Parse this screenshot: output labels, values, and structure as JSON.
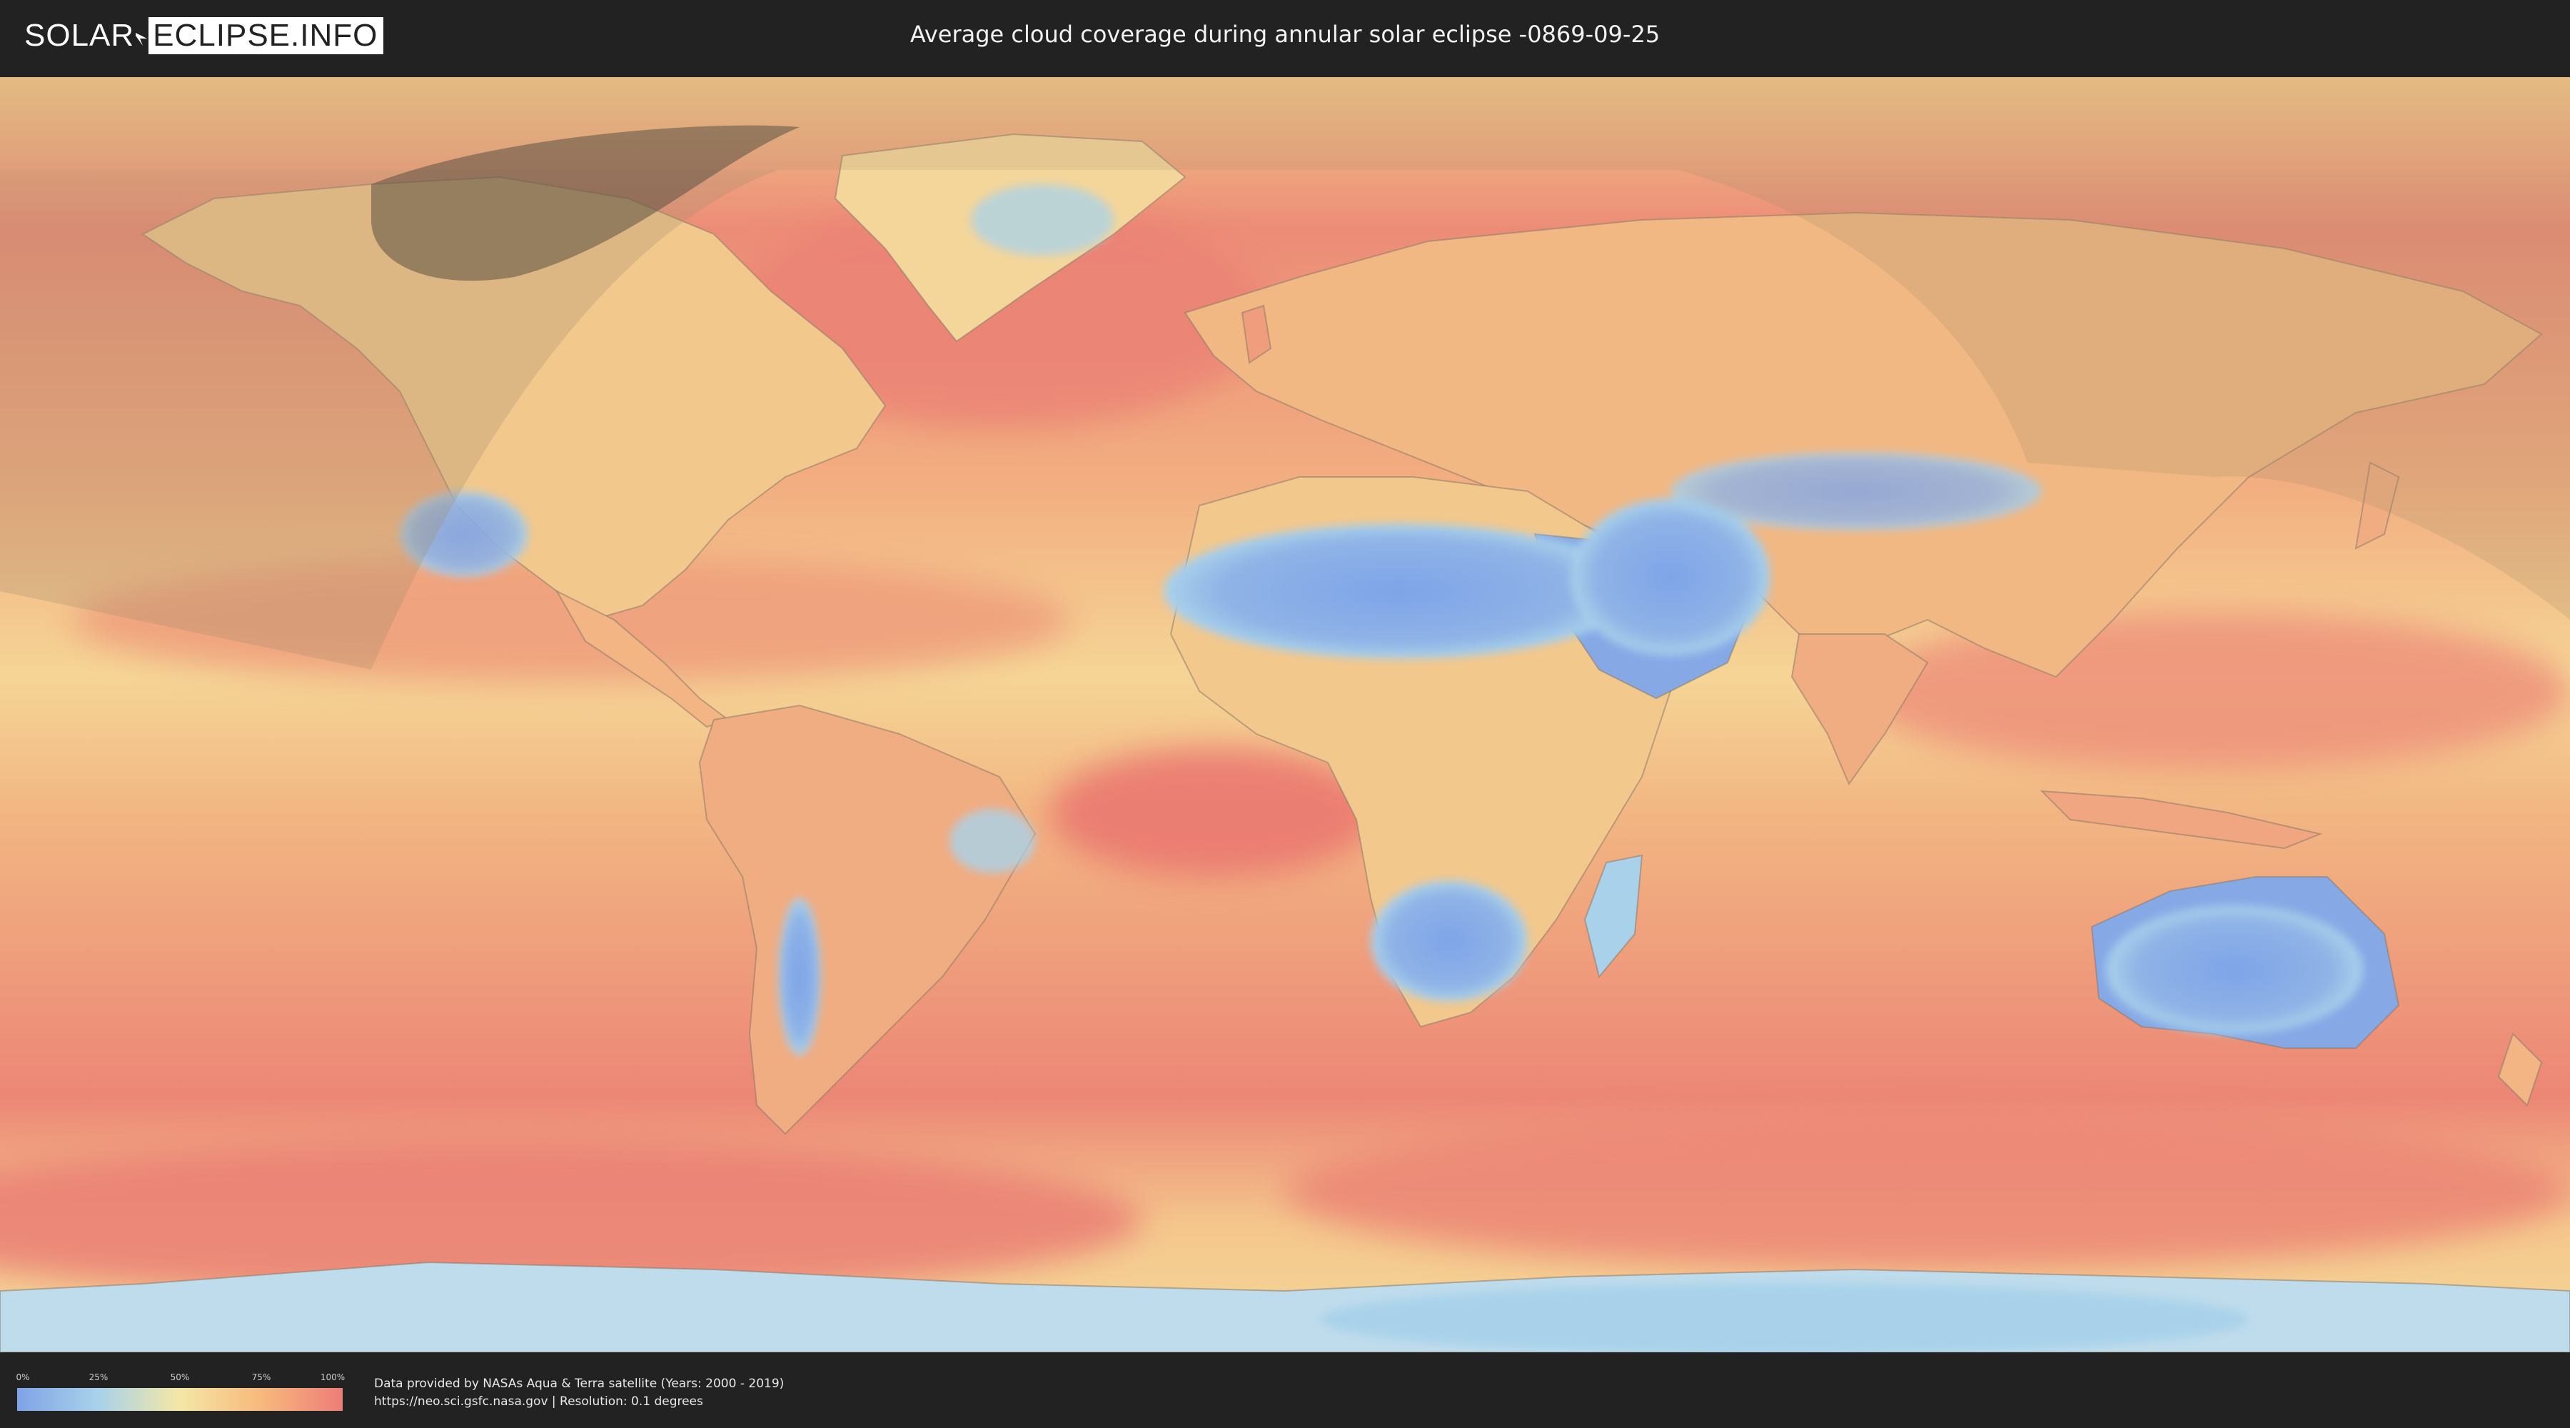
{
  "header": {
    "logo_left": "SOLAR",
    "logo_right": "ECLIPSE.INFO",
    "title": "Average cloud coverage during annular solar eclipse -0869-09-25"
  },
  "legend": {
    "ticks": [
      "0%",
      "25%",
      "50%",
      "75%",
      "100%"
    ],
    "colors": [
      "#7fa3e6",
      "#a9d2ea",
      "#f4e7a6",
      "#f7b97c",
      "#ee7d78"
    ]
  },
  "footer": {
    "credit_line1": "Data provided by NASAs Aqua & Terra satellite (Years: 2000 - 2019)",
    "credit_line2": "https://neo.sci.gsfc.nasa.gov | Resolution: 0.1 degrees"
  },
  "map": {
    "projection": "equirectangular",
    "palette": {
      "ocean_cloudy": "#ee8a78",
      "mid": "#f4c48c",
      "clear": "#7fa3e6",
      "light": "#a9d2ea",
      "border": "#8a7a6a"
    },
    "overlays": [
      "eclipse-visibility-shading",
      "annular-path-shadow"
    ]
  }
}
